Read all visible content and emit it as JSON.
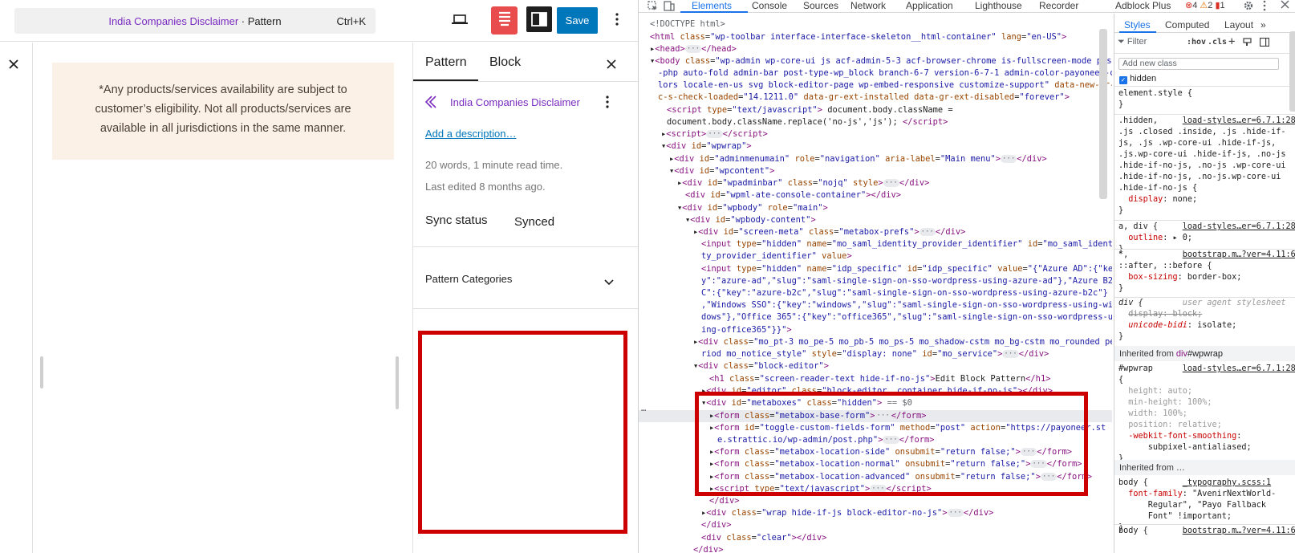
{
  "editor": {
    "command_bar": {
      "title": "India Companies Disclaimer",
      "suffix": " · Pattern",
      "shortcut": "Ctrl+K"
    },
    "toolbar": {
      "save_label": "Save"
    },
    "notice_text": "*Any products/services availability are subject to customer’s eligibility. Not all products/services are available in all jurisdictions in the same manner.",
    "inspector": {
      "tabs": [
        "Pattern",
        "Block"
      ],
      "pattern_title": "India Companies Disclaimer",
      "add_description": "Add a description…",
      "stats": "20 words, 1 minute read time.",
      "last_edited": "Last edited 8 months ago.",
      "sync_label": "Sync status",
      "sync_value": "Synced",
      "categories_label": "Pattern Categories"
    },
    "colors": {
      "accent": "#0076bb",
      "pattern_purple": "#7a2bc0",
      "notice_bg": "#fcf1e6",
      "highlight_red": "#cc0000",
      "style_book_red": "#e84c4c"
    }
  },
  "devtools": {
    "tabs": [
      "Elements",
      "Console",
      "Sources",
      "Network",
      "Application",
      "Lighthouse",
      "Recorder",
      "Adblock Plus"
    ],
    "badges": {
      "errors": "4",
      "warnings": "2",
      "issues": "1"
    },
    "styles_tabs": [
      "Styles",
      "Computed",
      "Layout"
    ],
    "filter_placeholder": "Filter",
    "hov": ":hov",
    "cls": ".cls",
    "new_class_placeholder": "Add new class",
    "hidden_checkbox": "hidden",
    "selected_marker": "== $0",
    "ellipsis_marker": "…"
  }
}
